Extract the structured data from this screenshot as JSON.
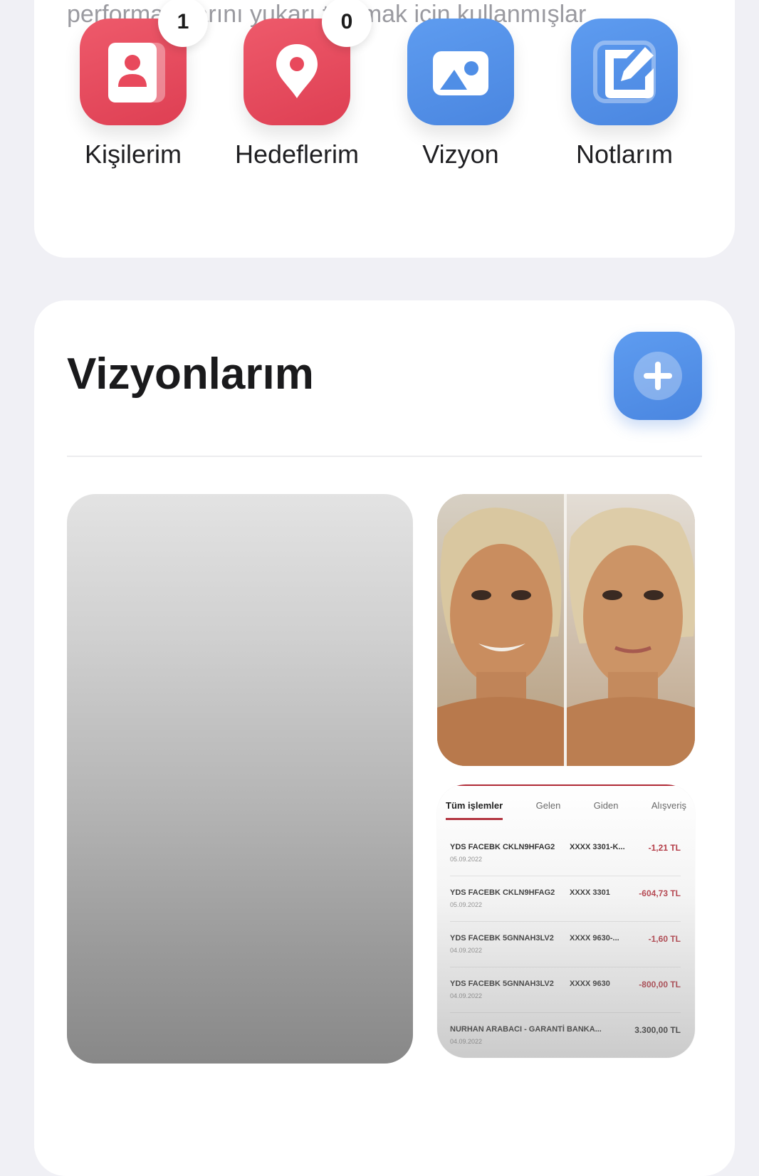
{
  "intro": {
    "text": "performanslarını yukarı taşımak için kullanmışlar"
  },
  "shortcuts": [
    {
      "label": "Kişilerim",
      "badge": "1",
      "color": "#e8495c",
      "icon": "contact-card-icon"
    },
    {
      "label": "Hedeflerim",
      "badge": "0",
      "color": "#e8495c",
      "icon": "location-pin-icon"
    },
    {
      "label": "Vizyon",
      "color": "#4f8ee6",
      "icon": "image-icon"
    },
    {
      "label": "Notlarım",
      "color": "#4f8ee6",
      "icon": "edit-note-icon"
    }
  ],
  "visions_section": {
    "title": "Vizyonlarım",
    "add_icon": "plus-icon",
    "accent": "#4f8ee6"
  },
  "statement": {
    "tabs": [
      "Tüm işlemler",
      "Gelen",
      "Giden",
      "Alışveriş"
    ],
    "rows": [
      {
        "desc": "YDS FACEBK CKLN9HFAG2",
        "card": "XXXX 3301-K...",
        "date": "05.09.2022",
        "amount": "-1,21 TL"
      },
      {
        "desc": "YDS FACEBK CKLN9HFAG2",
        "card": "XXXX 3301",
        "date": "05.09.2022",
        "amount": "-604,73 TL"
      },
      {
        "desc": "YDS FACEBK 5GNNAH3LV2",
        "card": "XXXX 9630-...",
        "date": "04.09.2022",
        "amount": "-1,60 TL"
      },
      {
        "desc": "YDS FACEBK 5GNNAH3LV2",
        "card": "XXXX 9630",
        "date": "04.09.2022",
        "amount": "-800,00 TL"
      },
      {
        "desc": "NURHAN ARABACI - GARANTİ BANKA...",
        "card": "",
        "date": "04.09.2022",
        "amount": "3.300,00 TL"
      }
    ]
  },
  "colors": {
    "red_tile": "#e8495c",
    "blue_tile": "#4f8ee6",
    "negative_amount": "#b12a36"
  }
}
